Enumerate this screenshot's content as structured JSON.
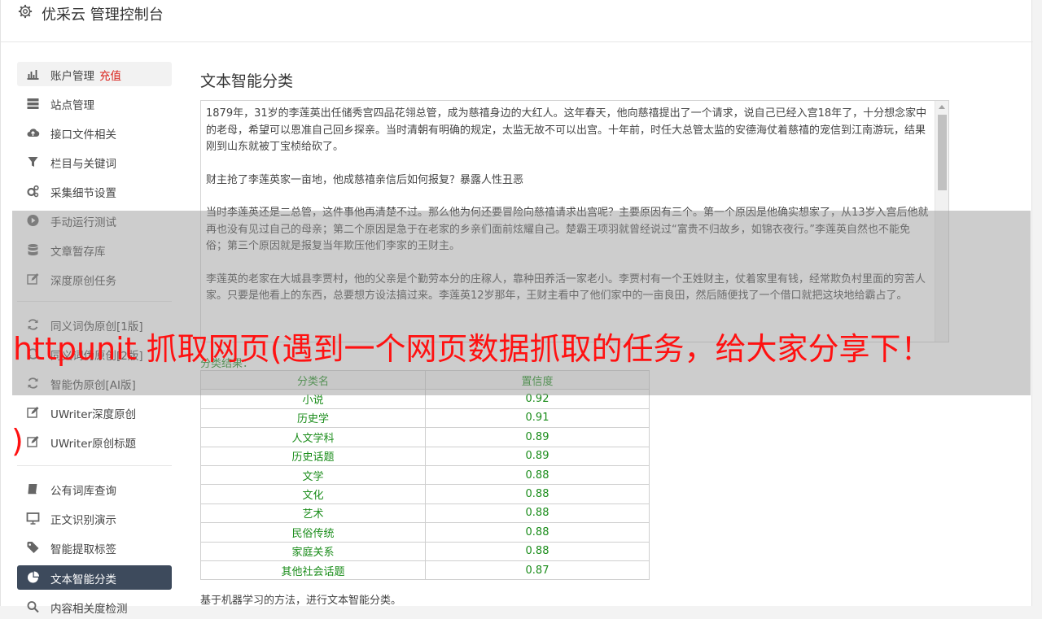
{
  "app": {
    "title": "优采云 管理控制台",
    "icon": "gear-icon"
  },
  "sidebar": {
    "items": [
      {
        "label": "账户管理",
        "badge": "充值",
        "icon": "bar-chart-icon"
      },
      {
        "label": "站点管理",
        "icon": "server-icon"
      },
      {
        "label": "接口文件相关",
        "icon": "cloud-upload-icon"
      },
      {
        "label": "栏目与关键词",
        "icon": "filter-icon"
      },
      {
        "label": "采集细节设置",
        "icon": "cogs-icon"
      },
      {
        "label": "手动运行测试",
        "icon": "play-circle-icon"
      },
      {
        "label": "文章暂存库",
        "icon": "database-icon"
      },
      {
        "label": "深度原创任务",
        "icon": "edit-icon"
      },
      {
        "label": "同义词伪原创[1版]",
        "icon": "refresh-icon"
      },
      {
        "label": "同义词伪原创[2版]",
        "icon": "refresh-icon"
      },
      {
        "label": "智能伪原创[AI版]",
        "icon": "refresh-icon"
      },
      {
        "label": "UWriter深度原创",
        "icon": "edit-icon"
      },
      {
        "label": "UWriter原创标题",
        "icon": "edit-icon"
      },
      {
        "label": "公有词库查询",
        "icon": "book-icon"
      },
      {
        "label": "正文识别演示",
        "icon": "monitor-icon"
      },
      {
        "label": "智能提取标签",
        "icon": "tag-icon"
      },
      {
        "label": "文本智能分类",
        "icon": "pie-chart-icon"
      },
      {
        "label": "内容相关度检测",
        "icon": "search-icon"
      }
    ]
  },
  "main": {
    "title": "文本智能分类",
    "article": [
      "1879年，31岁的李莲英出任储秀宫四品花翎总管，成为慈禧身边的大红人。这年春天，他向慈禧提出了一个请求，说自己已经入宫18年了，十分想念家中的老母，希望可以恩准自己回乡探亲。当时清朝有明确的规定，太监无故不可以出宫。十年前，时任大总管太监的安德海仗着慈禧的宠信到江南游玩，结果刚到山东就被丁宝桢给砍了。",
      "财主抢了李莲英家一亩地，他成慈禧亲信后如何报复？暴露人性丑恶",
      "当时李莲英还是二总管，这件事他再清楚不过。那么他为何还要冒险向慈禧请求出宫呢？主要原因有三个。第一个原因是他确实想家了，从13岁入宫后他就再也没有见过自己的母亲；第二个原因是急于在老家的乡亲们面前炫耀自己。楚霸王项羽就曾经说过“富贵不归故乡，如锦衣夜行。”李莲英自然也不能免俗；第三个原因就是报复当年欺压他们李家的王财主。",
      "李莲英的老家在大城县李贾村，他的父亲是个勤劳本分的庄稼人，靠种田养活一家老小。李贾村有一个王姓财主，仗着家里有钱，经常欺负村里面的穷苦人家。只要是他看上的东西，总要想方设法搞过来。李莲英12岁那年，王财主看中了他们家中的一亩良田，然后随便找了一个借口就把这块地给霸占了。"
    ],
    "result_label": "分类结果：",
    "table": {
      "headers": [
        "分类名",
        "置信度"
      ],
      "rows": [
        [
          "小说",
          "0.92"
        ],
        [
          "历史学",
          "0.91"
        ],
        [
          "人文学科",
          "0.89"
        ],
        [
          "历史话题",
          "0.89"
        ],
        [
          "文学",
          "0.88"
        ],
        [
          "文化",
          "0.88"
        ],
        [
          "艺术",
          "0.88"
        ],
        [
          "民俗传统",
          "0.88"
        ],
        [
          "家庭关系",
          "0.88"
        ],
        [
          "其他社会话题",
          "0.87"
        ]
      ]
    },
    "footer_note": "基于机器学习的方法，进行文本智能分类。"
  },
  "overlay": {
    "title": "httpunit 抓取网页(遇到一个网页数据抓取的任务，给大家分享下！",
    "paren": ")"
  },
  "colors": {
    "accent_red": "#ff1111",
    "active_nav": "#3d4a5c",
    "result_green": "#1a8c1a"
  }
}
